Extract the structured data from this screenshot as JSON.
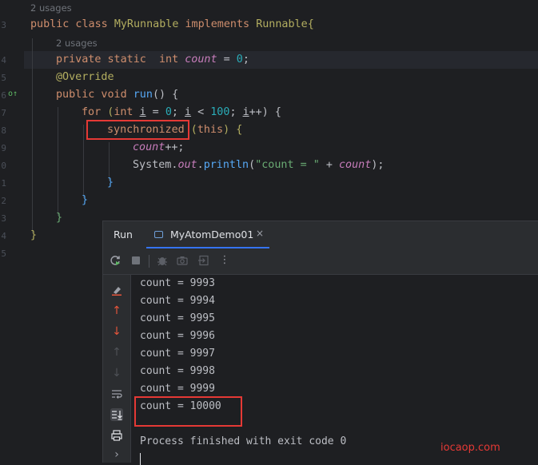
{
  "editor": {
    "usages_top": "2 usages",
    "usages_field": "2 usages",
    "line_numbers": [
      "3",
      "4",
      "5",
      "6",
      "7",
      "8",
      "9",
      "0",
      "1",
      "2",
      "3",
      "4",
      "5"
    ],
    "code": {
      "class_kw": "public class ",
      "class_name": "MyRunnable",
      "implements_kw": " implements ",
      "iface": "Runnable",
      "brace_open": "{",
      "field_mods": "private static  ",
      "field_type": "int ",
      "field_name": "count",
      "field_assign": " = ",
      "field_value": "0",
      "semicolon": ";",
      "annotation": "@Override",
      "method_mods": "public void ",
      "method_name": "run",
      "method_params": "() {",
      "for_kw": "for ",
      "for_paren": "(",
      "for_int": "int ",
      "for_i": "i",
      "for_init": " = ",
      "for_zero": "0",
      "for_semi1": "; ",
      "for_cond_i": "i",
      "for_lt": " < ",
      "for_limit": "100",
      "for_semi2": "; ",
      "for_inc_i": "i",
      "for_inc": "++) {",
      "sync_kw": "synchronized",
      "sync_open": " (",
      "sync_this": "this",
      "sync_close": ") {",
      "incr_field": "count",
      "incr_op": "++;",
      "print_class": "System.",
      "print_out": "out",
      "print_dot": ".",
      "print_fn": "println",
      "print_open": "(",
      "print_str": "\"count = \"",
      "print_plus": " + ",
      "print_field": "count",
      "print_close": ");",
      "close_brace": "}"
    }
  },
  "run_panel": {
    "title": "Run",
    "tab_label": "MyAtomDemo01",
    "tab_close": "×",
    "toolbar_icons": [
      "rerun-icon",
      "stop-icon",
      "debug-icon",
      "camera-icon",
      "exit-icon",
      "more-icon"
    ],
    "more_glyph": "⋮",
    "side_icons": [
      "eraser-icon",
      "arrow-up-icon",
      "arrow-down-icon",
      "arrow-up-disabled-icon",
      "arrow-down-disabled-icon",
      "soft-wrap-icon",
      "scroll-to-end-icon",
      "print-icon",
      "expand-icon"
    ],
    "output": [
      "count = 9993",
      "count = 9994",
      "count = 9995",
      "count = 9996",
      "count = 9997",
      "count = 9998",
      "count = 9999",
      "count = 10000"
    ],
    "finished": "Process finished with exit code 0",
    "accent": "#3574f0"
  },
  "watermark": "iocaop.com",
  "colors": {
    "highlight_box": "#e53935"
  }
}
